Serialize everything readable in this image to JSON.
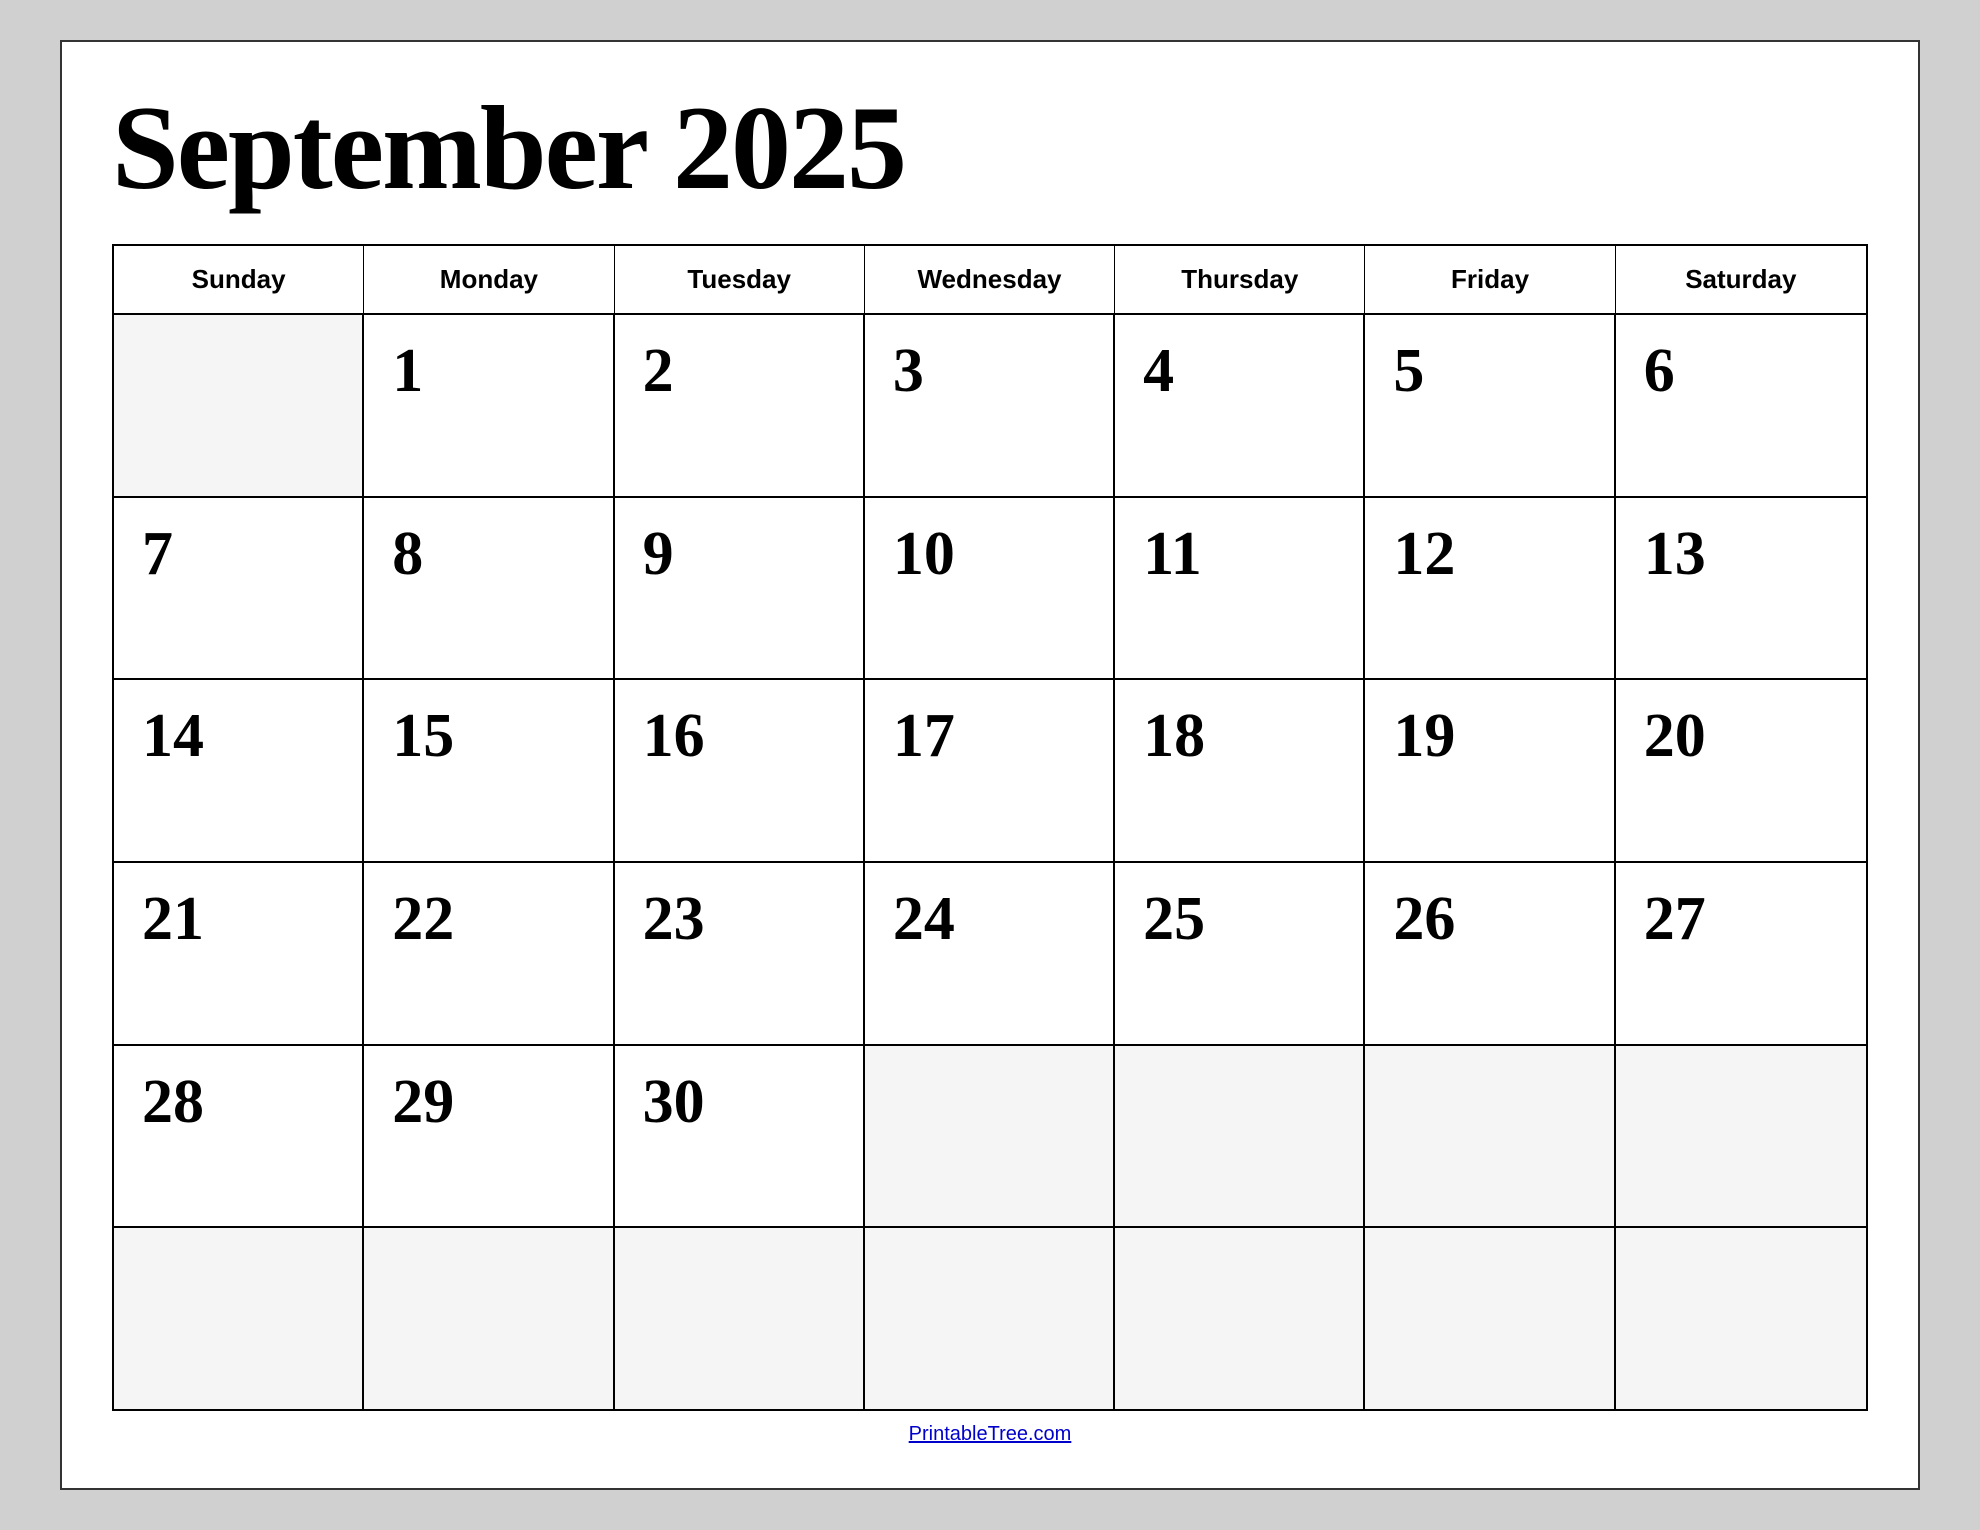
{
  "title": "September 2025",
  "headers": [
    "Sunday",
    "Monday",
    "Tuesday",
    "Wednesday",
    "Thursday",
    "Friday",
    "Saturday"
  ],
  "weeks": [
    [
      {
        "date": "",
        "empty": true
      },
      {
        "date": "1"
      },
      {
        "date": "2"
      },
      {
        "date": "3"
      },
      {
        "date": "4"
      },
      {
        "date": "5"
      },
      {
        "date": "6"
      }
    ],
    [
      {
        "date": "7"
      },
      {
        "date": "8"
      },
      {
        "date": "9"
      },
      {
        "date": "10"
      },
      {
        "date": "11"
      },
      {
        "date": "12"
      },
      {
        "date": "13"
      }
    ],
    [
      {
        "date": "14"
      },
      {
        "date": "15"
      },
      {
        "date": "16"
      },
      {
        "date": "17"
      },
      {
        "date": "18"
      },
      {
        "date": "19"
      },
      {
        "date": "20"
      }
    ],
    [
      {
        "date": "21"
      },
      {
        "date": "22"
      },
      {
        "date": "23"
      },
      {
        "date": "24"
      },
      {
        "date": "25"
      },
      {
        "date": "26"
      },
      {
        "date": "27"
      }
    ],
    [
      {
        "date": "28"
      },
      {
        "date": "29"
      },
      {
        "date": "30"
      },
      {
        "date": "",
        "empty": true
      },
      {
        "date": "",
        "empty": true
      },
      {
        "date": "",
        "empty": true
      },
      {
        "date": "",
        "empty": true
      }
    ],
    [
      {
        "date": "",
        "empty": true
      },
      {
        "date": "",
        "empty": true
      },
      {
        "date": "",
        "empty": true
      },
      {
        "date": "",
        "empty": true
      },
      {
        "date": "",
        "empty": true
      },
      {
        "date": "",
        "empty": true
      },
      {
        "date": "",
        "empty": true
      }
    ]
  ],
  "footer_link": "PrintableTree.com",
  "footer_url": "https://PrintableTree.com"
}
